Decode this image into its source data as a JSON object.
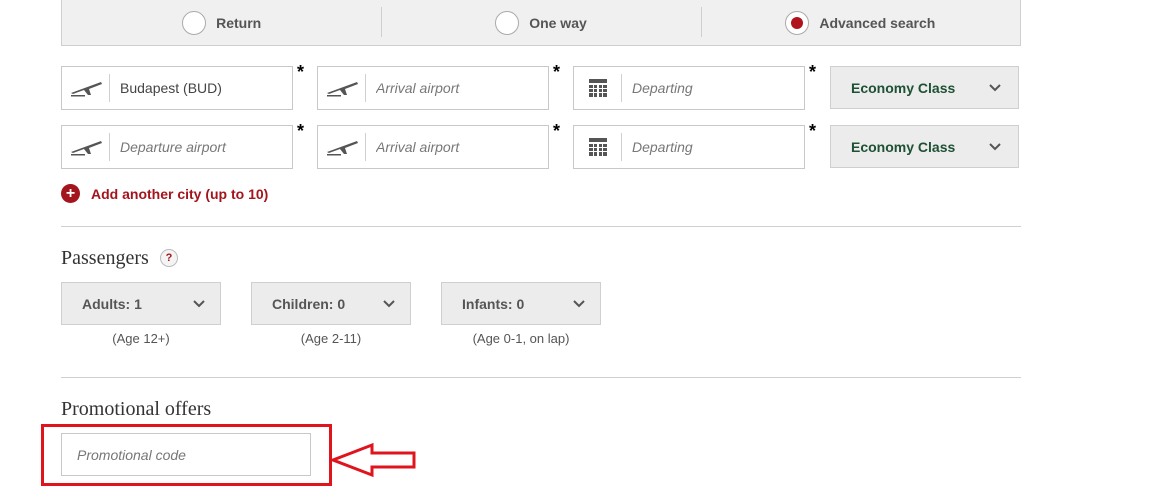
{
  "trip_types": {
    "return": {
      "label": "Return",
      "selected": false
    },
    "one_way": {
      "label": "One way",
      "selected": false
    },
    "advanced": {
      "label": "Advanced search",
      "selected": true
    }
  },
  "segments": [
    {
      "departure": {
        "value": "Budapest (BUD)",
        "placeholder": "Departure airport"
      },
      "arrival": {
        "value": "",
        "placeholder": "Arrival airport"
      },
      "date": {
        "value": "",
        "placeholder": "Departing"
      },
      "cabin": "Economy Class"
    },
    {
      "departure": {
        "value": "",
        "placeholder": "Departure airport"
      },
      "arrival": {
        "value": "",
        "placeholder": "Arrival airport"
      },
      "date": {
        "value": "",
        "placeholder": "Departing"
      },
      "cabin": "Economy Class"
    }
  ],
  "required_marker": "*",
  "add_city": {
    "icon": "plus-circle-icon",
    "label": "Add another city (up to 10)"
  },
  "passengers": {
    "title": "Passengers",
    "help": "?",
    "adults": {
      "label": "Adults: 1",
      "age": "(Age 12+)"
    },
    "children": {
      "label": "Children: 0",
      "age": "(Age 2-11)"
    },
    "infants": {
      "label": "Infants: 0",
      "age": "(Age 0-1, on lap)"
    }
  },
  "promotional": {
    "title": "Promotional offers",
    "placeholder": "Promotional code",
    "value": ""
  },
  "colors": {
    "accent": "#a3141c",
    "cabin_text": "#1e5034",
    "annotation": "#e0141c"
  }
}
